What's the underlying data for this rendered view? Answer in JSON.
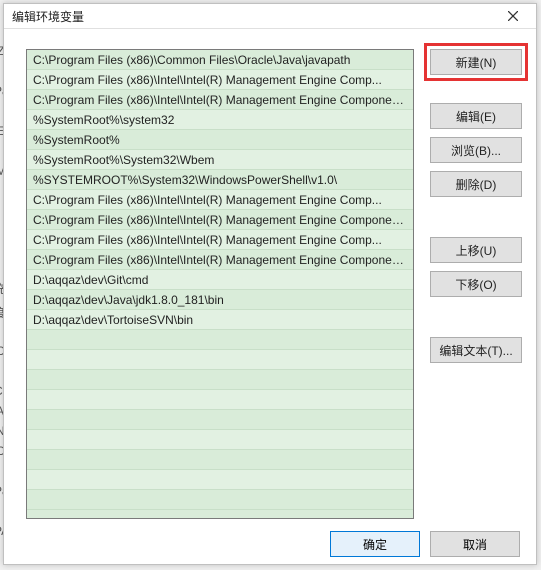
{
  "dialog": {
    "title": "编辑环境变量"
  },
  "paths": [
    "C:\\Program Files (x86)\\Common Files\\Oracle\\Java\\javapath",
    "C:\\Program Files (x86)\\Intel\\Intel(R) Management Engine Comp...",
    "C:\\Program Files (x86)\\Intel\\Intel(R) Management Engine Component...",
    "%SystemRoot%\\system32",
    "%SystemRoot%",
    "%SystemRoot%\\System32\\Wbem",
    "%SYSTEMROOT%\\System32\\WindowsPowerShell\\v1.0\\",
    "C:\\Program Files (x86)\\Intel\\Intel(R) Management Engine Comp...",
    "C:\\Program Files (x86)\\Intel\\Intel(R) Management Engine Component...",
    "C:\\Program Files (x86)\\Intel\\Intel(R) Management Engine Comp...",
    "C:\\Program Files (x86)\\Intel\\Intel(R) Management Engine Component...",
    "D:\\aqqaz\\dev\\Git\\cmd",
    "D:\\aqqaz\\dev\\Java\\jdk1.8.0_181\\bin",
    "D:\\aqqaz\\dev\\TortoiseSVN\\bin"
  ],
  "buttons": {
    "new": "新建(N)",
    "edit": "编辑(E)",
    "browse": "浏览(B)...",
    "delete": "删除(D)",
    "moveUp": "上移(U)",
    "moveDown": "下移(O)",
    "editText": "编辑文本(T)...",
    "ok": "确定",
    "cancel": "取消"
  },
  "bgHints": [
    "Z",
    "Pa",
    "E",
    "M",
    "充",
    "度",
    "Cl",
    "Co",
    "A",
    "N",
    "O",
    "Pa",
    "PA"
  ]
}
